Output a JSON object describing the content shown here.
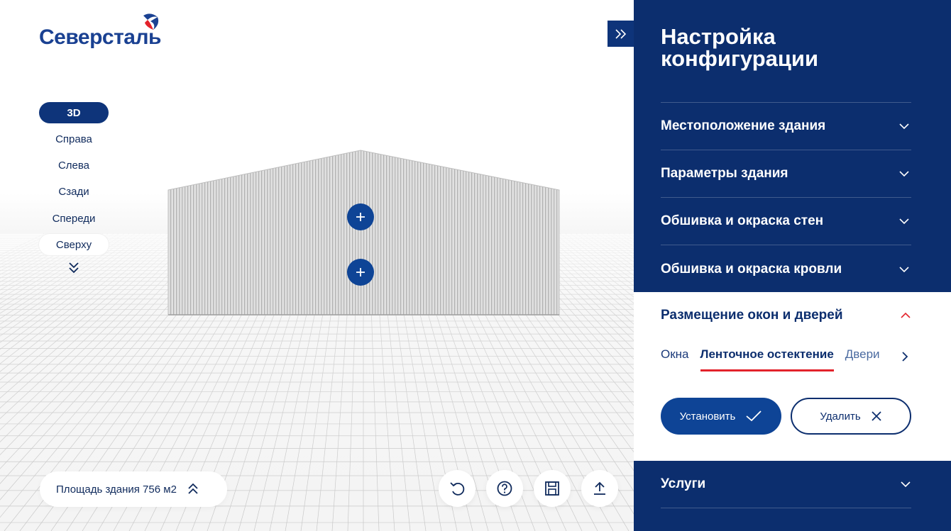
{
  "brand": {
    "logo_text": "Северсталь",
    "color": "#1a4192"
  },
  "colors": {
    "panel_bg": "#0c2e6e",
    "accent_blue": "#0e4496",
    "accent_red": "#e3222b"
  },
  "view_menu": {
    "items": [
      {
        "label": "3D",
        "active": true
      },
      {
        "label": "Справа"
      },
      {
        "label": "Слева"
      },
      {
        "label": "Сзади"
      },
      {
        "label": "Спереди"
      },
      {
        "label": "Сверху"
      }
    ],
    "more_icon": "double-chevron-down-icon"
  },
  "scene": {
    "hotspot_icon": "plus-icon"
  },
  "area": {
    "label": "Площадь здания 756 м2",
    "icon": "double-chevron-up-icon"
  },
  "tools": [
    {
      "name": "undo",
      "icon": "undo-icon"
    },
    {
      "name": "help",
      "icon": "help-icon"
    },
    {
      "name": "save",
      "icon": "save-icon"
    },
    {
      "name": "export",
      "icon": "upload-icon"
    }
  ],
  "panel": {
    "collapse_icon": "double-chevron-right-icon",
    "title": "Настройка конфигурации",
    "sections": [
      {
        "label": "Местоположение здания"
      },
      {
        "label": "Параметры здания"
      },
      {
        "label": "Обшивка и окраска стен"
      },
      {
        "label": "Обшивка и окраска кровли"
      }
    ],
    "open_section": {
      "label": "Размещение окон и дверей",
      "tabs": [
        {
          "label": "Окна"
        },
        {
          "label": "Ленточное остектение",
          "active": true
        },
        {
          "label": "Двери"
        }
      ],
      "install_label": "Установить",
      "delete_label": "Удалить"
    },
    "services_label": "Услуги"
  }
}
